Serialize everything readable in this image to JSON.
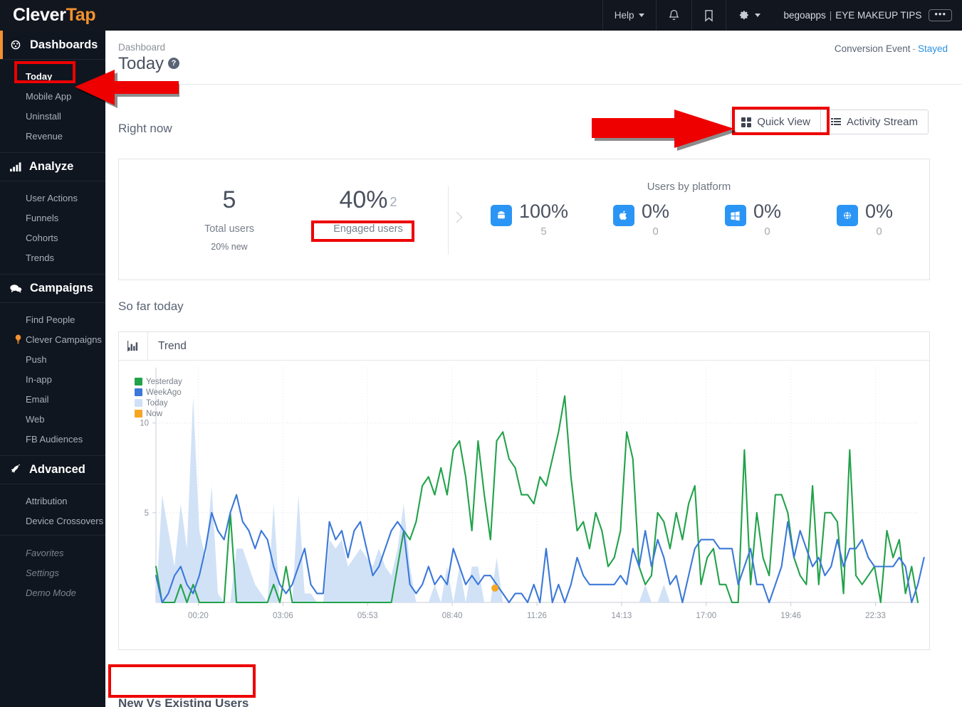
{
  "brand": {
    "part1": "Clever",
    "part2": "Tap"
  },
  "topbar": {
    "help_label": "Help",
    "notifications_icon": "bell-icon",
    "bookmark_icon": "bookmark-icon",
    "settings_icon": "gear-icon",
    "account_name": "begoapps",
    "account_separator": "|",
    "account_app": "EYE MAKEUP TIPS",
    "more_label": "•••"
  },
  "sidebar": {
    "groups": [
      {
        "label": "Dashboards",
        "icon": "dashboard-icon",
        "active": true,
        "items": [
          {
            "label": "Today",
            "selected": true
          },
          {
            "label": "Mobile App"
          },
          {
            "label": "Uninstall"
          },
          {
            "label": "Revenue"
          }
        ]
      },
      {
        "label": "Analyze",
        "icon": "bar-chart-icon",
        "active": false,
        "items": [
          {
            "label": "User Actions"
          },
          {
            "label": "Funnels"
          },
          {
            "label": "Cohorts"
          },
          {
            "label": "Trends"
          }
        ]
      },
      {
        "label": "Campaigns",
        "icon": "chat-bubbles-icon",
        "active": false,
        "items": [
          {
            "label": "Find People"
          },
          {
            "label": "Clever Campaigns",
            "icon": "lightbulb-icon"
          },
          {
            "label": "Push"
          },
          {
            "label": "In-app"
          },
          {
            "label": "Email"
          },
          {
            "label": "Web"
          },
          {
            "label": "FB Audiences"
          }
        ]
      },
      {
        "label": "Advanced",
        "icon": "rocket-icon",
        "active": false,
        "items": [
          {
            "label": "Attribution"
          },
          {
            "label": "Device Crossovers"
          }
        ]
      }
    ],
    "footer_items": [
      {
        "label": "Favorites"
      },
      {
        "label": "Settings"
      },
      {
        "label": "Demo Mode"
      }
    ]
  },
  "page": {
    "breadcrumb": "Dashboard",
    "title": "Today",
    "help_badge": "?",
    "conversion_label": "Conversion Event",
    "conversion_dash": "-",
    "conversion_value": "Stayed"
  },
  "view_toggle": {
    "quick_view": "Quick View",
    "activity_stream": "Activity Stream",
    "selected": "Quick View"
  },
  "right_now": {
    "section_title": "Right now",
    "total_users": {
      "value": "5",
      "label": "Total users",
      "note": "20% new"
    },
    "engaged_users": {
      "value": "40%",
      "count": "2",
      "label": "Engaged users"
    },
    "platform_title": "Users by platform",
    "platforms": [
      {
        "icon": "android-icon",
        "percent": "100%",
        "count": "5"
      },
      {
        "icon": "apple-icon",
        "percent": "0%",
        "count": "0"
      },
      {
        "icon": "windows-icon",
        "percent": "0%",
        "count": "0"
      },
      {
        "icon": "web-globe-icon",
        "percent": "0%",
        "count": "0"
      }
    ]
  },
  "so_far_today": {
    "section_title": "So far today",
    "card_icon": "bar-chart-icon",
    "card_label": "Trend"
  },
  "bottom": {
    "title": "New Vs Existing Users"
  },
  "colors": {
    "brand_orange": "#f2912f",
    "sidebar_bg": "#101620",
    "topbar_bg": "#12161e",
    "link_blue": "#2b91e0",
    "platform_icon_blue": "#2b95f5",
    "annotation_red": "#ee0000",
    "yesterday": "#22a24a",
    "weekago": "#3b78d8",
    "today": "#cfe0f7",
    "now": "#f5a623"
  },
  "chart_data": {
    "type": "line",
    "title": "Trend",
    "xlabel": "",
    "ylabel": "",
    "ylim": [
      0,
      13
    ],
    "yticks": [
      5,
      10
    ],
    "grid": true,
    "legend_position": "top-left",
    "xtick_labels": [
      "00:20",
      "03:06",
      "05:53",
      "08:40",
      "11:26",
      "14:13",
      "17:00",
      "19:46",
      "22:33"
    ],
    "series": [
      {
        "name": "Yesterday",
        "color": "#22a24a",
        "type": "line",
        "values": [
          2,
          0,
          0,
          0,
          1,
          0,
          1,
          0,
          0,
          0,
          0,
          0,
          5,
          0,
          0,
          0,
          0,
          0,
          0,
          1,
          0,
          2,
          0,
          0,
          0,
          0,
          0,
          0,
          0,
          0,
          0,
          0,
          0,
          0,
          0,
          0,
          0,
          0,
          0,
          2,
          4,
          3.5,
          4.5,
          6.5,
          7,
          6,
          7.5,
          6,
          8.5,
          9,
          7,
          4,
          9,
          6,
          3.5,
          9,
          9.5,
          8,
          7.5,
          6,
          6,
          5.5,
          7,
          6.5,
          8,
          9.5,
          11.5,
          7,
          4,
          4.5,
          3,
          5,
          4,
          2,
          2.5,
          4,
          9.5,
          8,
          2,
          1,
          1.5,
          5,
          4.5,
          3,
          5,
          3.5,
          5.5,
          6.5,
          1,
          2.5,
          3,
          1,
          1,
          0,
          0,
          8.5,
          1,
          5,
          2.5,
          1.5,
          6,
          6,
          5,
          2.5,
          1.5,
          1,
          6.5,
          1,
          5,
          5,
          4.5,
          0.5,
          8.5,
          1.5,
          1,
          1.5,
          2,
          0,
          4,
          2.5,
          3.5,
          0.5,
          2,
          0
        ]
      },
      {
        "name": "WeekAgo",
        "color": "#3b78d8",
        "type": "line",
        "values": [
          1.5,
          0,
          0.5,
          1.5,
          2,
          1,
          0.5,
          1.5,
          3,
          5,
          4,
          3.5,
          5,
          6,
          4.5,
          4,
          3,
          4,
          3.5,
          2,
          1,
          0.5,
          1,
          2,
          3,
          1,
          0.5,
          0.5,
          4.5,
          3.5,
          4,
          2.5,
          4,
          4.5,
          3,
          1.5,
          2,
          3,
          4,
          4.5,
          4,
          1,
          0.5,
          1,
          2,
          1,
          1.5,
          1,
          3,
          2,
          1,
          1.5,
          1,
          1.5,
          1.5,
          1,
          0.5,
          0,
          0.5,
          0.5,
          0,
          1,
          0,
          3,
          0,
          1,
          0,
          1,
          2.5,
          1.5,
          1,
          1,
          1,
          1,
          1,
          1.5,
          1,
          3,
          2,
          4,
          2,
          3.5,
          2.5,
          1,
          1.5,
          0,
          1.5,
          3,
          3.5,
          3.5,
          3.5,
          3,
          3,
          3,
          1,
          2,
          3,
          1,
          1,
          0,
          1,
          2,
          4.5,
          2.5,
          4,
          3,
          2,
          2.5,
          1.5,
          2,
          3.5,
          2,
          3,
          3,
          3.5,
          2.5,
          2,
          2,
          2,
          2,
          2.5,
          2,
          0,
          1,
          2.5
        ]
      },
      {
        "name": "Today",
        "color": "#cfe0f7",
        "type": "area",
        "values": [
          0,
          6,
          4,
          2,
          5.5,
          3,
          11.5,
          4,
          2.5,
          6.5,
          0.5,
          0,
          0,
          3,
          3,
          2,
          1,
          0.5,
          0,
          5.5,
          0,
          0,
          0,
          6,
          0.5,
          0.5,
          0,
          0,
          3.5,
          3,
          3.5,
          2,
          2.5,
          3,
          2.5,
          2,
          3,
          2,
          1.5,
          3,
          5.5,
          2,
          0,
          0,
          0,
          1,
          0,
          2,
          0,
          2,
          0,
          2,
          2,
          0,
          0,
          2.5,
          0,
          0,
          0,
          0,
          0,
          0,
          0,
          0,
          0,
          0,
          0,
          0,
          0,
          0,
          0,
          0,
          0,
          0,
          0,
          0,
          0,
          0,
          0,
          1,
          0,
          0,
          1,
          0,
          0,
          0,
          0,
          0,
          0,
          0,
          0,
          0,
          0,
          0,
          0,
          0,
          0,
          0,
          0,
          0,
          0,
          0,
          0,
          0,
          0,
          0,
          0,
          0,
          0,
          0,
          0,
          0,
          0,
          0,
          0,
          0,
          0,
          0,
          0,
          0,
          0,
          0,
          0,
          0,
          0,
          0
        ]
      },
      {
        "name": "Now",
        "color": "#f5a623",
        "type": "point",
        "x": 0.445,
        "y": 0.8
      }
    ]
  },
  "annotations": [
    {
      "name": "today-sidebar-highlight"
    },
    {
      "name": "quick-view-highlight"
    },
    {
      "name": "engaged-users-highlight"
    },
    {
      "name": "new-vs-existing-highlight"
    },
    {
      "name": "arrow-to-today"
    },
    {
      "name": "arrow-to-quick-view"
    }
  ]
}
